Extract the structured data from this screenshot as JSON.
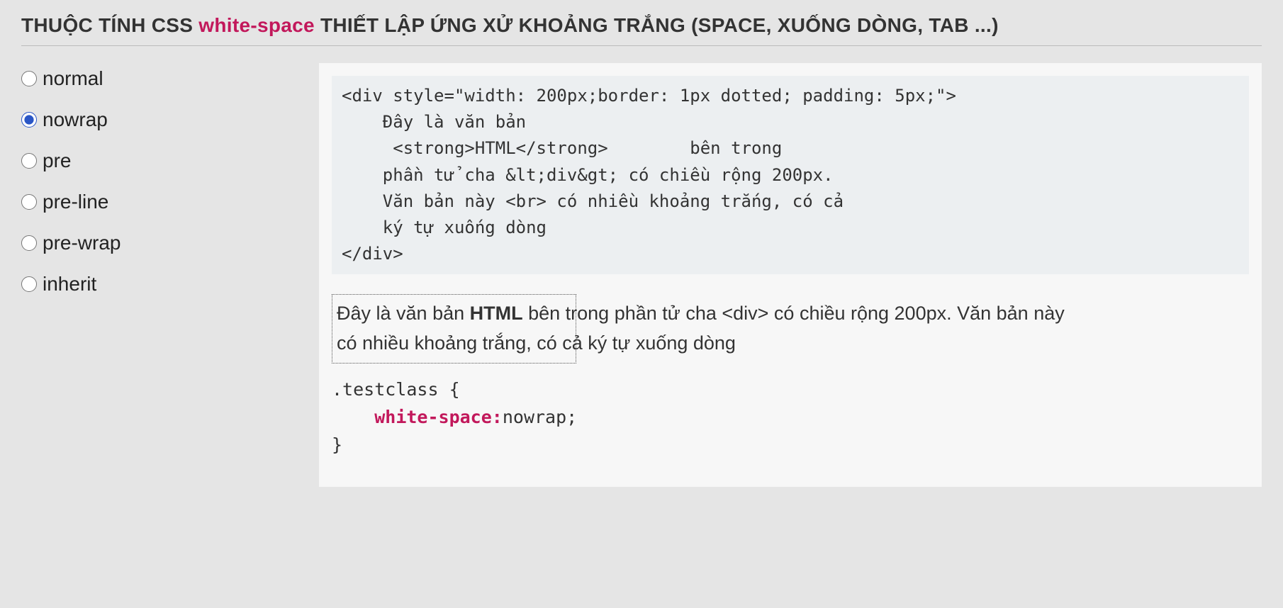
{
  "title": {
    "prefix": "THUỘC TÍNH CSS ",
    "highlight": "white-space",
    "suffix": " THIẾT LẬP ỨNG XỬ KHOẢNG TRẮNG (SPACE, XUỐNG DÒNG, TAB ...)"
  },
  "options": [
    {
      "value": "normal",
      "label": "normal",
      "selected": false
    },
    {
      "value": "nowrap",
      "label": "nowrap",
      "selected": true
    },
    {
      "value": "pre",
      "label": "pre",
      "selected": false
    },
    {
      "value": "pre-line",
      "label": "pre-line",
      "selected": false
    },
    {
      "value": "pre-wrap",
      "label": "pre-wrap",
      "selected": false
    },
    {
      "value": "inherit",
      "label": "inherit",
      "selected": false
    }
  ],
  "code_block": "<div style=\"width: 200px;border: 1px dotted; padding: 5px;\">\n    Đây là văn bản\n     <strong>HTML</strong>        bên trong\n    phần tử cha &lt;div&gt; có chiều rộng 200px.\n    Văn bản này <br> có nhiều khoảng trắng, có cả\n    ký tự xuống dòng\n</div>",
  "preview": {
    "part1": "Đây là văn bản ",
    "bold": "HTML",
    "part2": " bên trong phần tử cha <div> có chiều rộng 200px. Văn bản này",
    "part3": "có nhiều khoảng trắng, có cả ký tự xuống dòng"
  },
  "css_snippet": {
    "open": ".testclass {",
    "indent": "    ",
    "prop": "white-space:",
    "value": "nowrap;",
    "close": "}"
  }
}
